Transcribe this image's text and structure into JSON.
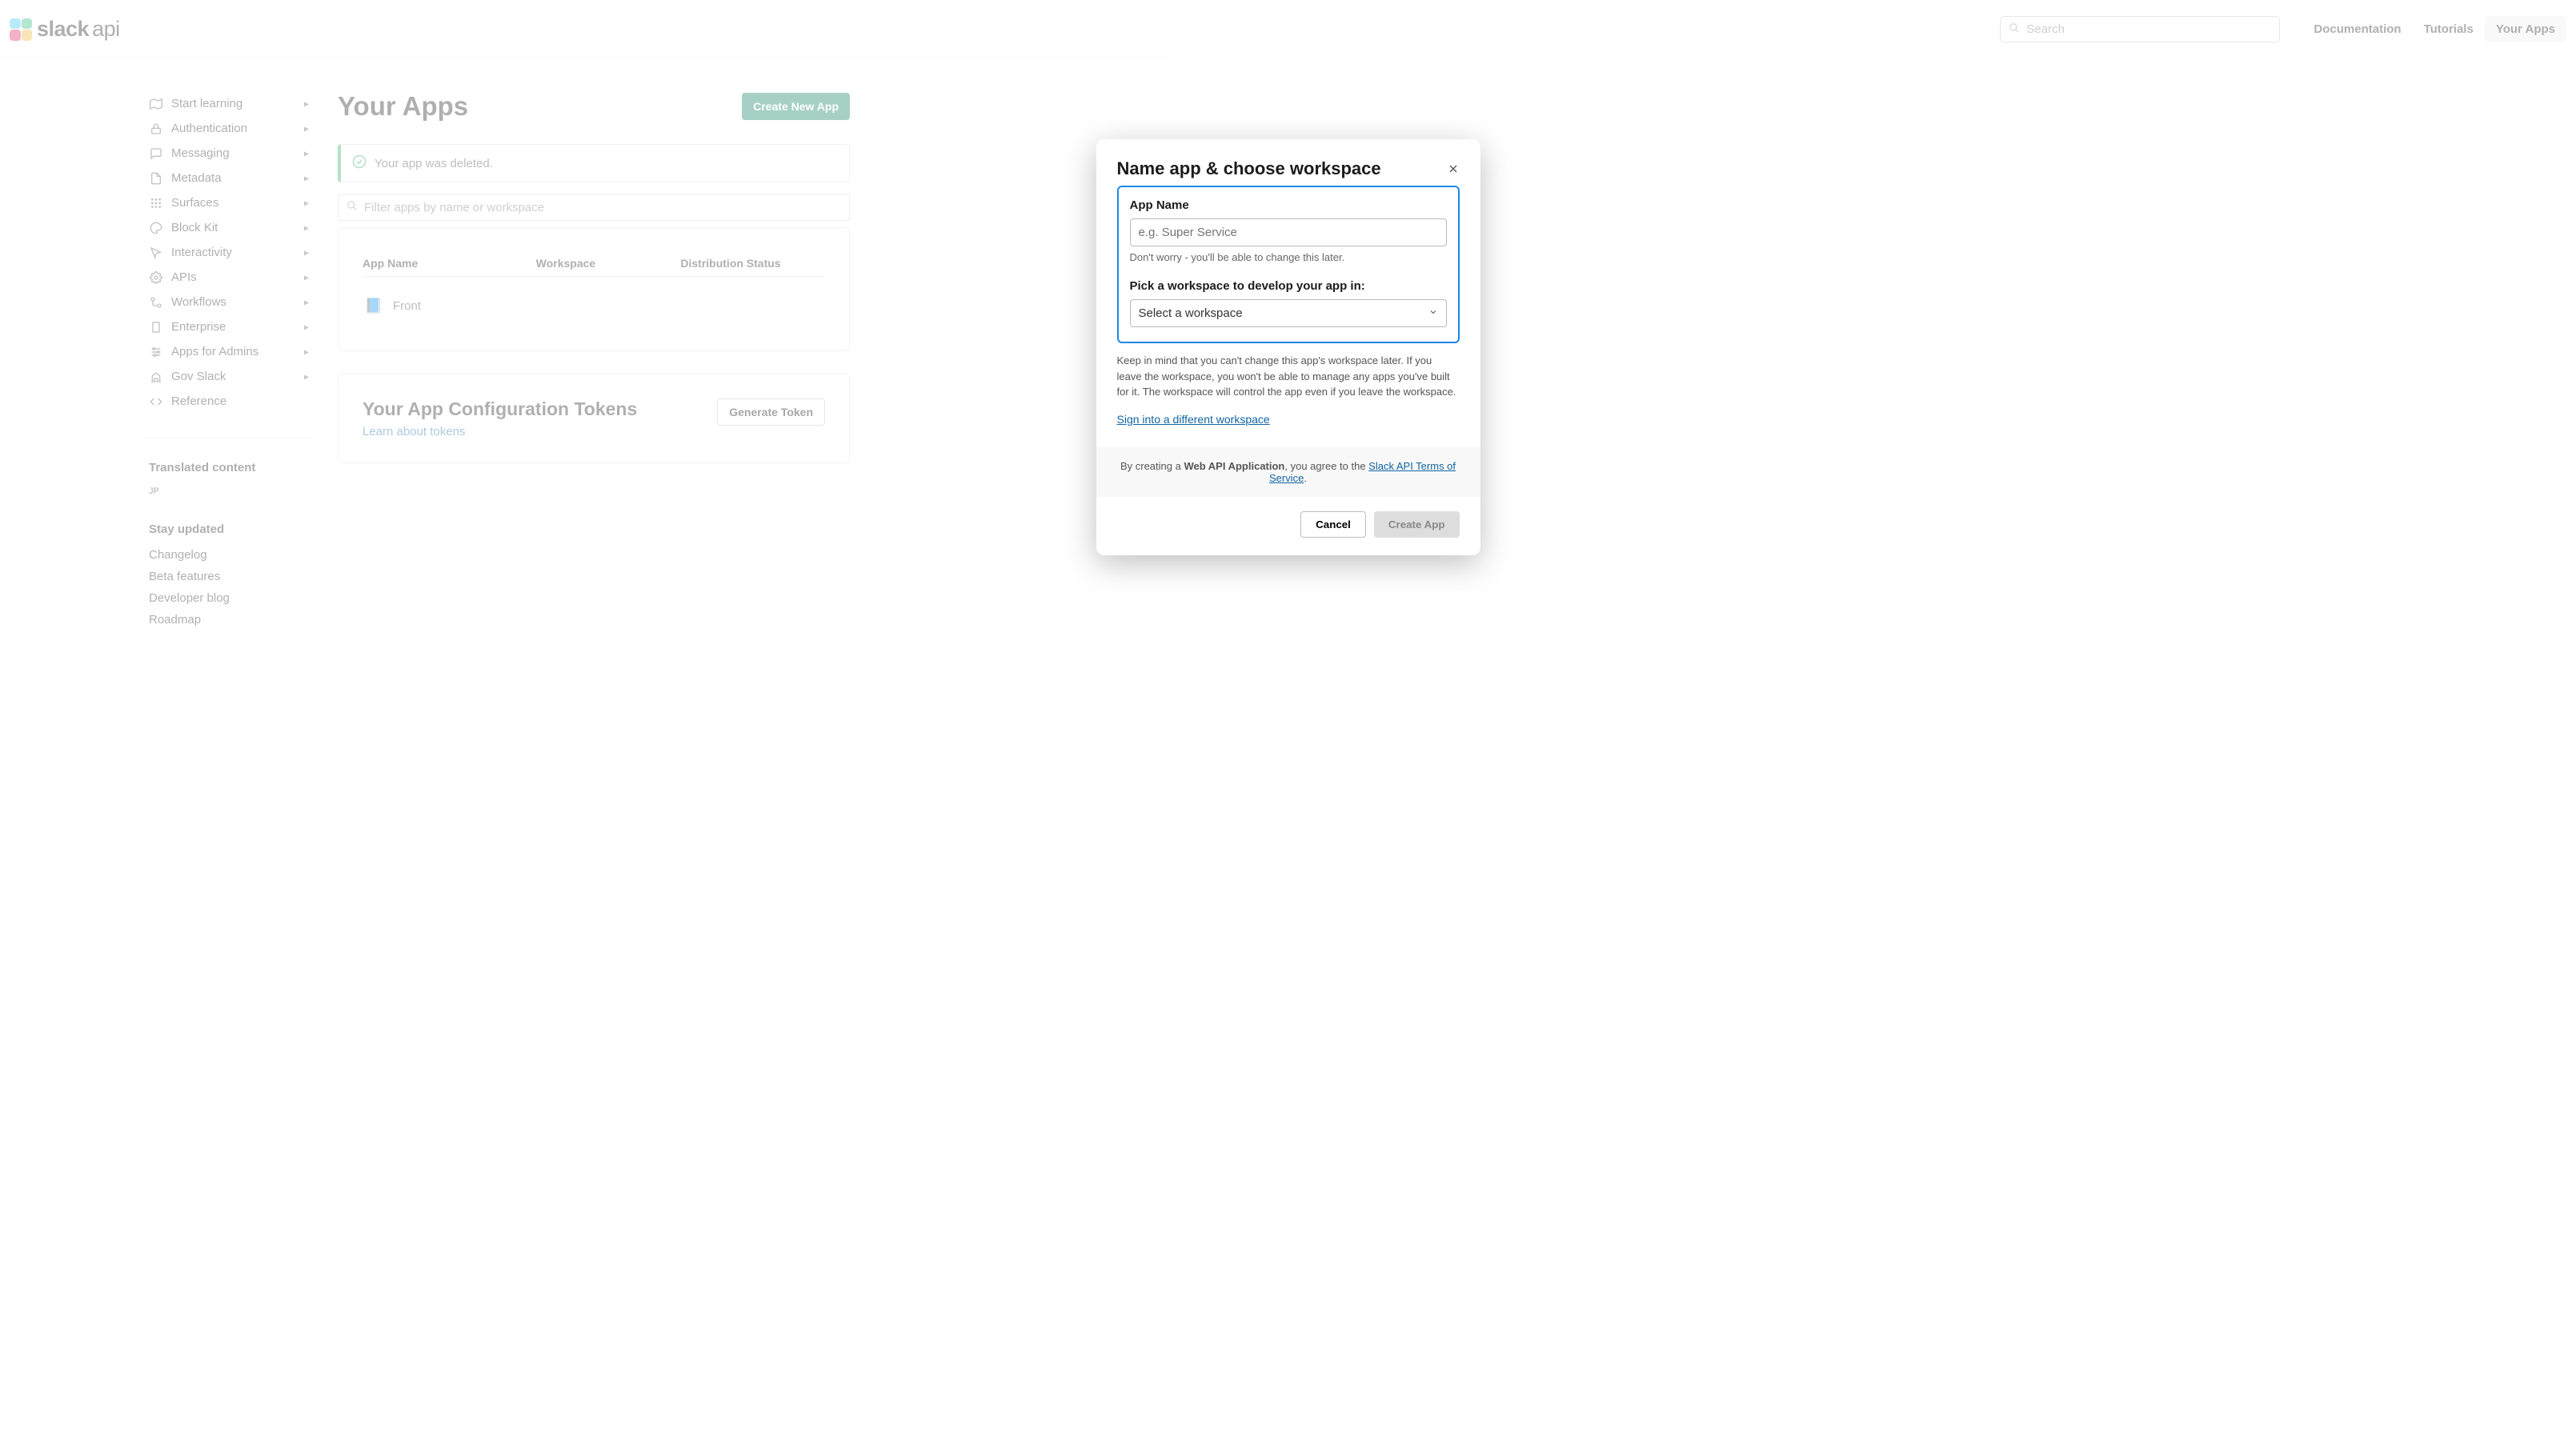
{
  "brand": {
    "name": "slack",
    "suffix": "api"
  },
  "topnav": {
    "search_placeholder": "Search",
    "links": {
      "docs": "Documentation",
      "tutorials": "Tutorials",
      "your_apps": "Your Apps"
    }
  },
  "sidebar": {
    "items": [
      {
        "label": "Start learning"
      },
      {
        "label": "Authentication"
      },
      {
        "label": "Messaging"
      },
      {
        "label": "Metadata"
      },
      {
        "label": "Surfaces"
      },
      {
        "label": "Block Kit"
      },
      {
        "label": "Interactivity"
      },
      {
        "label": "APIs"
      },
      {
        "label": "Workflows"
      },
      {
        "label": "Enterprise"
      },
      {
        "label": "Apps for Admins"
      },
      {
        "label": "Gov Slack"
      },
      {
        "label": "Reference"
      }
    ],
    "translated_heading": "Translated content",
    "translated_jp": "JP",
    "stay_heading": "Stay updated",
    "stay_links": {
      "changelog": "Changelog",
      "beta": "Beta features",
      "blog": "Developer blog",
      "roadmap": "Roadmap"
    }
  },
  "main": {
    "title": "Your Apps",
    "create_btn": "Create New App",
    "banner_text": "Your app was deleted.",
    "filter_placeholder": "Filter apps by name or workspace",
    "col_app": "App Name",
    "col_workspace": "Workspace",
    "col_dist": "Distribution Status",
    "app_row": {
      "name": "Front"
    },
    "cfg_title": "Your App Configuration Tokens",
    "cfg_learn": "Learn about tokens",
    "cfg_generate": "Generate Token"
  },
  "modal": {
    "title": "Name app & choose workspace",
    "field_app_name_label": "App Name",
    "field_app_name_placeholder": "e.g. Super Service",
    "field_app_name_hint": "Don't worry - you'll be able to change this later.",
    "field_ws_label": "Pick a workspace to develop your app in:",
    "select_placeholder": "Select a workspace",
    "ws_warning": "Keep in mind that you can't change this app's workspace later. If you leave the workspace, you won't be able to manage any apps you've built for it. The workspace will control the app even if you leave the workspace.",
    "sign_into": "Sign into a different workspace",
    "footer_prefix": "By creating a ",
    "footer_bold": "Web API Application",
    "footer_middle": ", you agree to the ",
    "footer_link": "Slack API Terms of Service",
    "footer_suffix": ".",
    "cancel": "Cancel",
    "create": "Create App"
  },
  "colors": {
    "accent_green": "#007a5a",
    "link_blue": "#1264a3",
    "focus_blue": "#1e88e5"
  }
}
